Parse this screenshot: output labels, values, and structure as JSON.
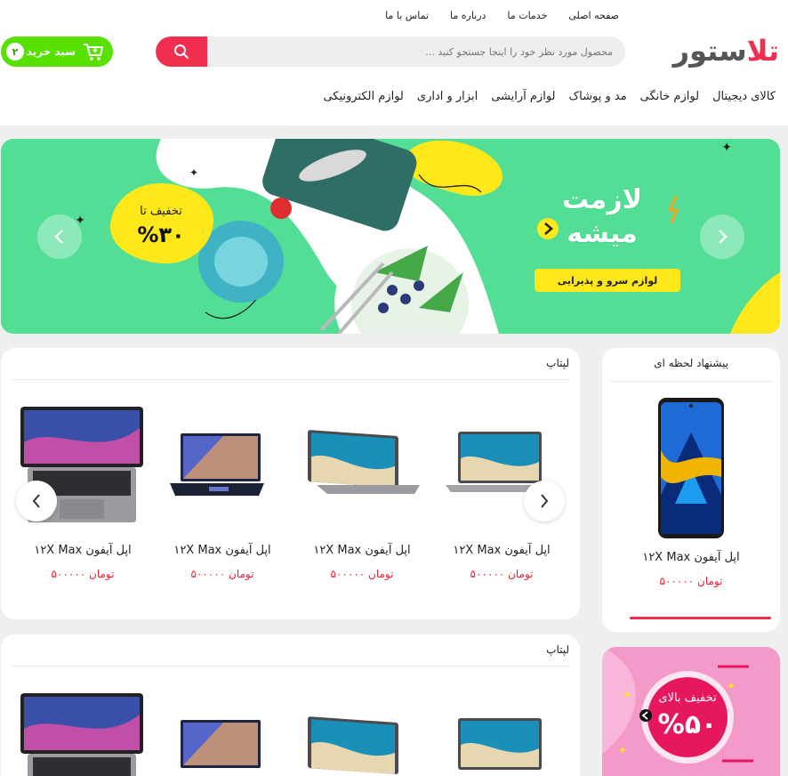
{
  "header": {
    "logo": {
      "part1": "تل",
      "part2": "استور"
    },
    "top_links": [
      "صفحه اصلی",
      "خدمات ما",
      "درباره ما",
      "تماس با ما"
    ],
    "search": {
      "placeholder": "محصول مورد نظر خود را اینجا جستجو کنید ..."
    },
    "cart": {
      "label": "سبد خرید",
      "count": "۲"
    },
    "categories": [
      "کالای دیجیتال",
      "لوازم خانگی",
      "مد و پوشاک",
      "لوازم آرایشی",
      "ابزار و اداری",
      "لوازم الکترونیکی"
    ]
  },
  "banner": {
    "headline_1": "لازمت",
    "headline_2": "میشه",
    "subtitle": "لوازم سرو و پذیرایی",
    "discount_label": "تخفیف تا",
    "discount_value": "%۳۰"
  },
  "sections": [
    {
      "title": "لپتاپ",
      "products": [
        {
          "name": "اپل آیفون ۱۲X Max",
          "price": "۵۰۰۰۰۰",
          "currency": "تومان"
        },
        {
          "name": "اپل آیفون ۱۲X Max",
          "price": "۵۰۰۰۰۰",
          "currency": "تومان"
        },
        {
          "name": "اپل آیفون ۱۲X Max",
          "price": "۵۰۰۰۰۰",
          "currency": "تومان"
        },
        {
          "name": "اپل آیفون ۱۲X Max",
          "price": "۵۰۰۰۰۰",
          "currency": "تومان"
        }
      ]
    },
    {
      "title": "لپتاپ"
    }
  ],
  "special_offer": {
    "title": "پیشنهاد لحظه ای",
    "product": {
      "name": "اپل آیفون ۱۲X Max",
      "price": "۵۰۰۰۰۰",
      "currency": "تومان"
    }
  },
  "promo_box": {
    "label": "تخفیف بالای",
    "value": "%۵۰"
  },
  "colors": {
    "accent": "#f02e4f",
    "cart": "#58e000",
    "banner": "#52de95",
    "yellow": "#ffe81a",
    "promo_pink": "#f8a3d3"
  },
  "icons": [
    "search-icon",
    "cart-icon",
    "chevron-left-icon",
    "chevron-right-icon"
  ]
}
